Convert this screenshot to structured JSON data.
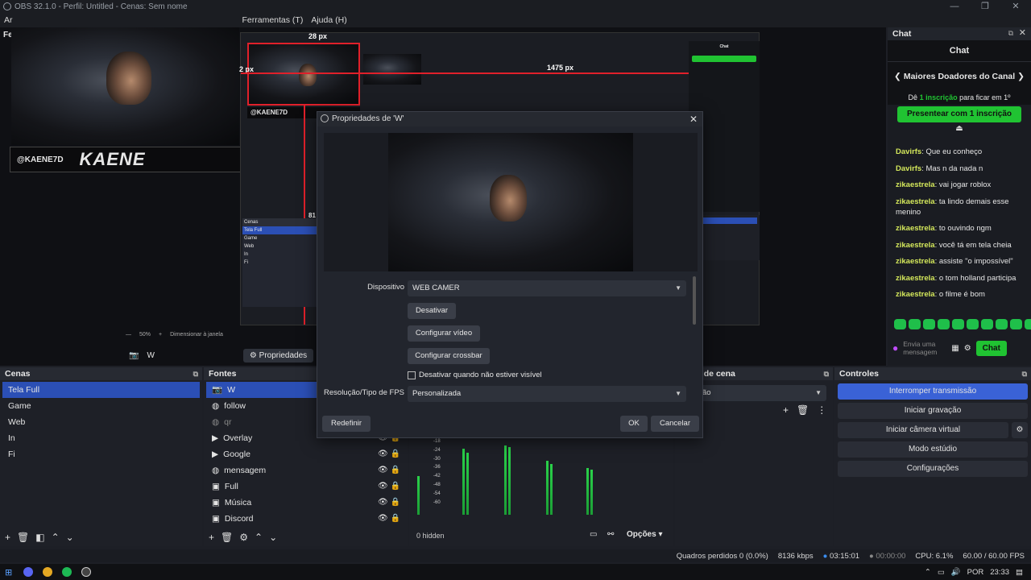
{
  "window": {
    "title": "OBS 32.1.0 - Perfil: Untitled - Cenas: Sem nome",
    "controls": [
      "—",
      "❐",
      "✕"
    ]
  },
  "menu": {
    "left_stub": "Ar",
    "items": [
      "Ferramentas (T)",
      "Ajuda (H)"
    ]
  },
  "preview": {
    "left_stub": "Fe",
    "watermark_handle": "@KAENE7D",
    "watermark_logo": "KAENE",
    "measure_top": "28 px",
    "measure_left": "2 px",
    "measure_right": "1475 px",
    "measure_mid": "81",
    "scenes_mini": [
      "Cenas",
      "Tela Full",
      "Game",
      "Web",
      "In",
      "Fi"
    ],
    "zoom": "50%",
    "resize_label": "Dimensionar à janela"
  },
  "source_bar": {
    "source": "W",
    "properties": "Propriedades"
  },
  "chat": {
    "dock_title": "Chat",
    "header": "Chat",
    "donors_title": "Maiores Doadores do Canal",
    "promo_prefix": "Dê",
    "promo_bold": "1 inscrição",
    "promo_suffix": "para ficar em 1º",
    "gift_button": "Presentear com 1 inscrição",
    "messages": [
      {
        "user": "Davirfs",
        "text": "Que eu conheço"
      },
      {
        "user": "Davirfs",
        "text": "Mas n da nada n"
      },
      {
        "user": "zikaestrela",
        "text": "vai jogar roblox"
      },
      {
        "user": "zikaestrela",
        "text": "ta lindo demais esse menino"
      },
      {
        "user": "zikaestrela",
        "text": "to ouvindo ngm"
      },
      {
        "user": "zikaestrela",
        "text": "você tá em tela cheia"
      },
      {
        "user": "zikaestrela",
        "text": "assiste \"o impossível\""
      },
      {
        "user": "zikaestrela",
        "text": "o tom holland participa"
      },
      {
        "user": "zikaestrela",
        "text": "o filme é bom"
      }
    ],
    "input_placeholder": "Envia uma mensagem",
    "send_button": "Chat"
  },
  "scenes": {
    "title": "Cenas",
    "items": [
      "Tela Full",
      "Game",
      "Web",
      "In",
      "Fi"
    ],
    "selected": 0
  },
  "sources": {
    "title": "Fontes",
    "items": [
      {
        "name": "W",
        "icon": "camera-icon"
      },
      {
        "name": "follow",
        "icon": "globe-icon"
      },
      {
        "name": "qr",
        "icon": "globe-icon"
      },
      {
        "name": "Overlay",
        "icon": "play-icon"
      },
      {
        "name": "Google",
        "icon": "play-icon"
      },
      {
        "name": "mensagem",
        "icon": "globe-icon"
      },
      {
        "name": "Full",
        "icon": "image-icon"
      },
      {
        "name": "Música",
        "icon": "image-icon"
      },
      {
        "name": "Discord",
        "icon": "image-icon"
      }
    ]
  },
  "transitions": {
    "title": "ições de cena",
    "value": "ão"
  },
  "mixer": {
    "hidden_label": "0 hidden",
    "options": "Opções",
    "db_marks": [
      "-18",
      "-24",
      "-30",
      "-36",
      "-42",
      "-48",
      "-54",
      "-60"
    ],
    "levels": [
      0.55,
      0.82,
      0.9,
      0.7,
      0.6
    ]
  },
  "controls": {
    "title": "Controles",
    "buttons": [
      "Interromper transmissão",
      "Iniciar gravação",
      "Iniciar câmera virtual",
      "Modo estúdio",
      "Configurações"
    ]
  },
  "dialog": {
    "title": "Propriedades de 'W'",
    "device_label": "Dispositivo",
    "device_value": "WEB CAMER",
    "deactivate": "Desativar",
    "config_video": "Configurar vídeo",
    "config_crossbar": "Configurar crossbar",
    "checkbox_label": "Desativar quando não estiver visível",
    "resolution_label": "Resolução/Tipo de FPS",
    "resolution_value": "Personalizada",
    "reset": "Redefinir",
    "ok": "OK",
    "cancel": "Cancelar"
  },
  "status": {
    "dropped": "Quadros perdidos 0 (0.0%)",
    "bitrate": "8136 kbps",
    "live_time": "03:15:01",
    "rec_time": "00:00:00",
    "cpu": "CPU: 6.1%",
    "fps": "60.00 / 60.00 FPS"
  },
  "taskbar": {
    "lang": "POR",
    "clock": "23:33"
  },
  "colors": {
    "accent": "#2b4fb5",
    "green": "#20c332",
    "red_guide": "#e0202a"
  }
}
